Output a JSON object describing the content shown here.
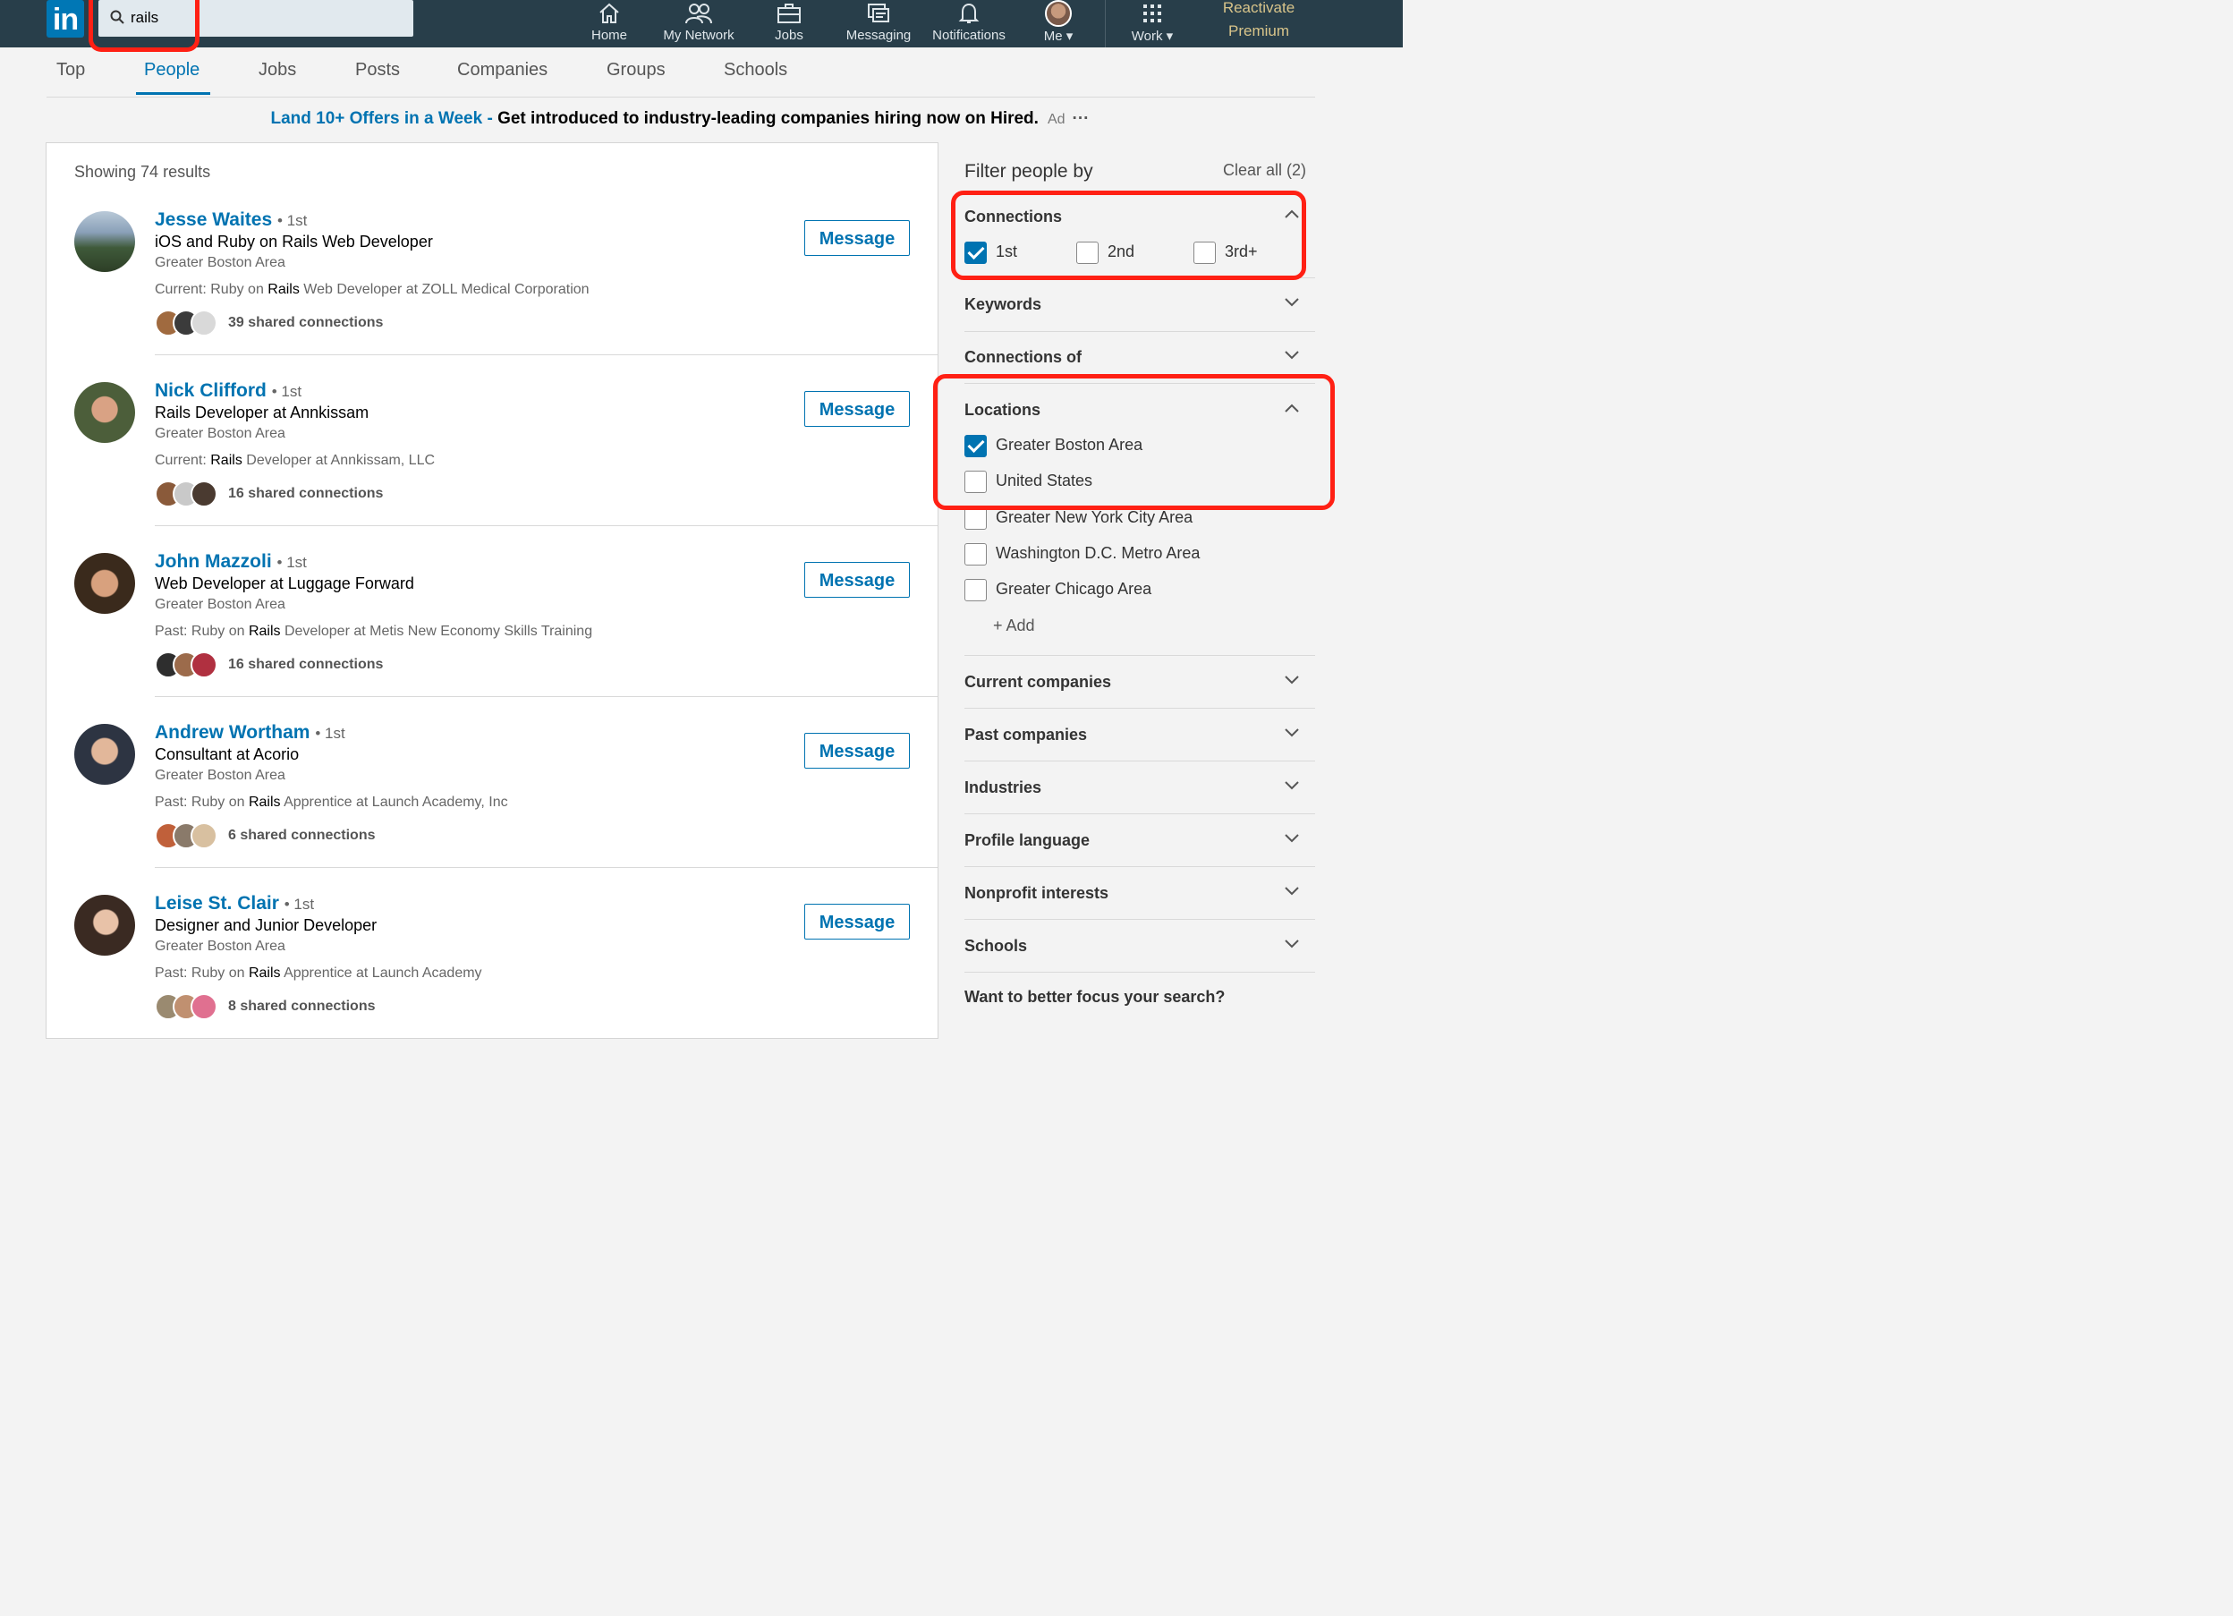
{
  "search": {
    "value": "rails"
  },
  "nav": [
    {
      "label": "Home",
      "icon": "home-icon"
    },
    {
      "label": "My Network",
      "icon": "network-icon"
    },
    {
      "label": "Jobs",
      "icon": "briefcase-icon"
    },
    {
      "label": "Messaging",
      "icon": "messaging-icon"
    },
    {
      "label": "Notifications",
      "icon": "bell-icon"
    },
    {
      "label": "Me ▾",
      "icon": "avatar"
    },
    {
      "label": "Work ▾",
      "icon": "grid-icon"
    }
  ],
  "premium": {
    "line1": "Reactivate",
    "line2": "Premium"
  },
  "tabs": [
    "Top",
    "People",
    "Jobs",
    "Posts",
    "Companies",
    "Groups",
    "Schools"
  ],
  "ad": {
    "link": "Land 10+ Offers in a Week - ",
    "text": "Get introduced to industry-leading companies hiring now on Hired.",
    "tag": "Ad",
    "more": "···"
  },
  "results": {
    "showing": "Showing 74 results",
    "message_label": "Message",
    "people": [
      {
        "name": "Jesse Waites",
        "degree": "• 1st",
        "headline": "iOS and Ruby on Rails Web Developer",
        "location": "Greater Boston Area",
        "snippet_pre": "Current: Ruby on ",
        "snippet_bold": "Rails",
        "snippet_post": " Web Developer at ZOLL Medical Corporation",
        "shared": "39 shared connections"
      },
      {
        "name": "Nick Clifford",
        "degree": "• 1st",
        "headline": "Rails Developer at Annkissam",
        "location": "Greater Boston Area",
        "snippet_pre": "Current: ",
        "snippet_bold": "Rails",
        "snippet_post": " Developer at Annkissam, LLC",
        "shared": "16 shared connections"
      },
      {
        "name": "John Mazzoli",
        "degree": "• 1st",
        "headline": "Web Developer at Luggage Forward",
        "location": "Greater Boston Area",
        "snippet_pre": "Past: Ruby on ",
        "snippet_bold": "Rails",
        "snippet_post": " Developer at Metis New Economy Skills Training",
        "shared": "16 shared connections"
      },
      {
        "name": "Andrew Wortham",
        "degree": "• 1st",
        "headline": "Consultant at Acorio",
        "location": "Greater Boston Area",
        "snippet_pre": "Past: Ruby on ",
        "snippet_bold": "Rails",
        "snippet_post": " Apprentice at Launch Academy, Inc",
        "shared": "6 shared connections"
      },
      {
        "name": "Leise St. Clair",
        "degree": "• 1st",
        "headline": "Designer and Junior Developer",
        "location": "Greater Boston Area",
        "snippet_pre": "Past: Ruby on ",
        "snippet_bold": "Rails",
        "snippet_post": " Apprentice at Launch Academy",
        "shared": "8 shared connections"
      }
    ]
  },
  "filters": {
    "heading": "Filter people by",
    "clear": "Clear all (2)",
    "connections": {
      "title": "Connections",
      "options": [
        {
          "label": "1st",
          "checked": true
        },
        {
          "label": "2nd",
          "checked": false
        },
        {
          "label": "3rd+",
          "checked": false
        }
      ]
    },
    "keywords": "Keywords",
    "connections_of": "Connections of",
    "locations": {
      "title": "Locations",
      "options": [
        {
          "label": "Greater Boston Area",
          "checked": true
        },
        {
          "label": "United States",
          "checked": false
        },
        {
          "label": "Greater New York City Area",
          "checked": false
        },
        {
          "label": "Washington D.C. Metro Area",
          "checked": false
        },
        {
          "label": "Greater Chicago Area",
          "checked": false
        }
      ],
      "add": "+ Add"
    },
    "collapsed": [
      "Current companies",
      "Past companies",
      "Industries",
      "Profile language",
      "Nonprofit interests",
      "Schools"
    ],
    "footer": "Want to better focus your search?"
  },
  "colors": {
    "brand": "#0073b1",
    "topbar": "#283e4a",
    "highlight": "#ff2014"
  }
}
